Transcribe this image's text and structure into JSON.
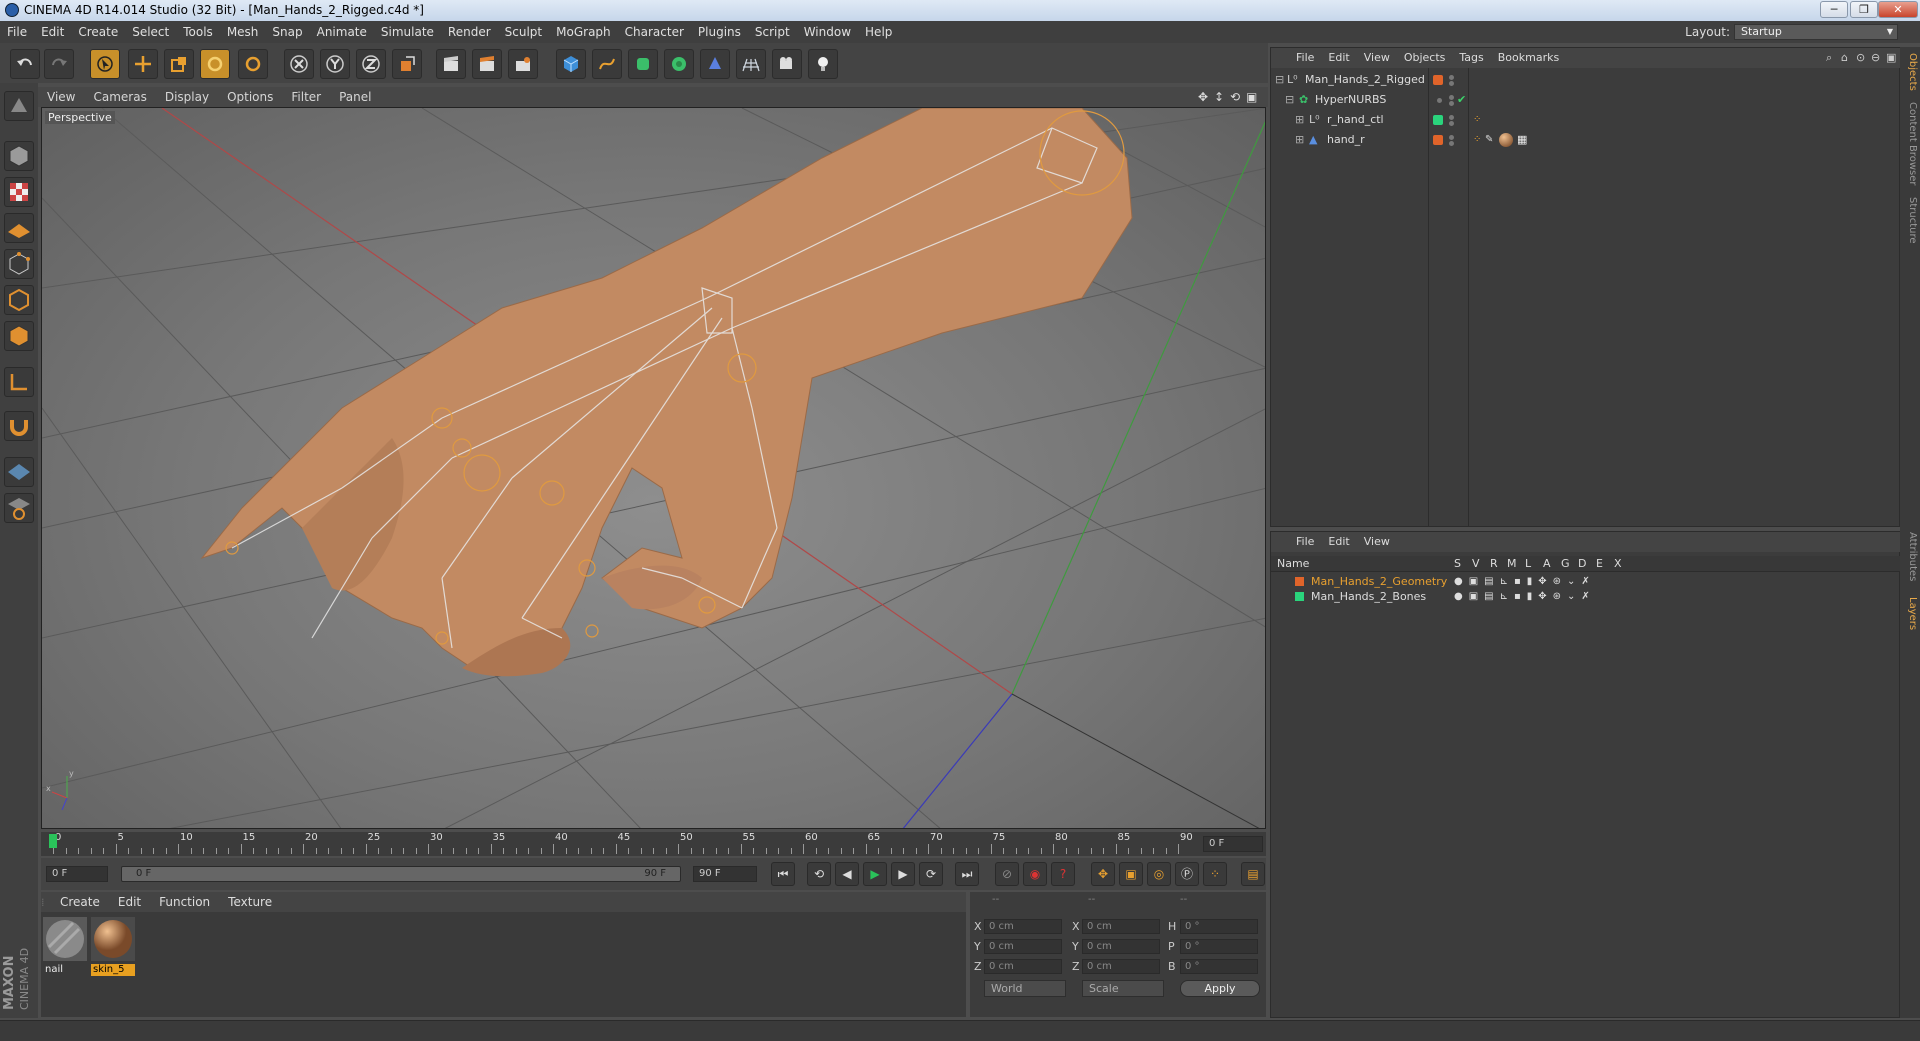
{
  "window": {
    "title": "CINEMA 4D R14.014 Studio (32 Bit) - [Man_Hands_2_Rigged.c4d *]",
    "minimize": "─",
    "restore": "❐",
    "close": "✕"
  },
  "menubar": {
    "items": [
      "File",
      "Edit",
      "Create",
      "Select",
      "Tools",
      "Mesh",
      "Snap",
      "Animate",
      "Simulate",
      "Render",
      "Sculpt",
      "MoGraph",
      "Character",
      "Plugins",
      "Script",
      "Window",
      "Help"
    ],
    "layout_label": "Layout:",
    "layout_value": "Startup"
  },
  "viewport": {
    "menu": [
      "View",
      "Cameras",
      "Display",
      "Options",
      "Filter",
      "Panel"
    ],
    "label": "Perspective",
    "colors": {
      "x_axis": "#c44a4a",
      "y_axis": "#4aa84a",
      "z_axis": "#4a4ac4",
      "skin": "#c48a60",
      "bones": "#e6e6e6",
      "joint": "#e0a040"
    }
  },
  "timeline": {
    "ticks": [
      "0",
      "5",
      "10",
      "15",
      "20",
      "25",
      "30",
      "35",
      "40",
      "45",
      "50",
      "55",
      "60",
      "65",
      "70",
      "75",
      "80",
      "85",
      "90"
    ],
    "current_frame": "0 F",
    "start_field": "0 F",
    "range_start": "0 F",
    "range_end": "90 F",
    "end_field": "90 F"
  },
  "material_manager": {
    "menu": [
      "Create",
      "Edit",
      "Function",
      "Texture"
    ],
    "materials": [
      {
        "name": "nail",
        "selected": false
      },
      {
        "name": "skin_5",
        "selected": true
      }
    ]
  },
  "coordinates": {
    "header": [
      "--",
      "--",
      "--"
    ],
    "rows": [
      {
        "a": "X",
        "av": "0 cm",
        "b": "X",
        "bv": "0 cm",
        "c": "H",
        "cv": "0 °"
      },
      {
        "a": "Y",
        "av": "0 cm",
        "b": "Y",
        "bv": "0 cm",
        "c": "P",
        "cv": "0 °"
      },
      {
        "a": "Z",
        "av": "0 cm",
        "b": "Z",
        "bv": "0 cm",
        "c": "B",
        "cv": "0 °"
      }
    ],
    "world": "World",
    "scale": "Scale",
    "apply": "Apply"
  },
  "logo": {
    "maxon": "MAXON",
    "cinema": "CINEMA 4D"
  },
  "object_manager": {
    "menu": [
      "File",
      "Edit",
      "View",
      "Objects",
      "Tags",
      "Bookmarks"
    ],
    "objects": [
      {
        "name": "Man_Hands_2_Rigged",
        "color": "#e0642a"
      },
      {
        "name": "HyperNURBS",
        "color": ""
      },
      {
        "name": "r_hand_ctl",
        "color": "#2ad47c"
      },
      {
        "name": "hand_r",
        "color": "#e0642a"
      }
    ]
  },
  "layer_manager": {
    "menu": [
      "File",
      "Edit",
      "View"
    ],
    "columns": [
      "Name",
      "S",
      "V",
      "R",
      "M",
      "L",
      "A",
      "G",
      "D",
      "E",
      "X"
    ],
    "layers": [
      {
        "name": "Man_Hands_2_Geometry",
        "color": "#e0642a",
        "highlight": true
      },
      {
        "name": "Man_Hands_2_Bones",
        "color": "#2ad47c",
        "highlight": false
      }
    ]
  },
  "right_tabs": [
    "Objects",
    "Content Browser",
    "Structure",
    "Attributes",
    "Layers"
  ]
}
